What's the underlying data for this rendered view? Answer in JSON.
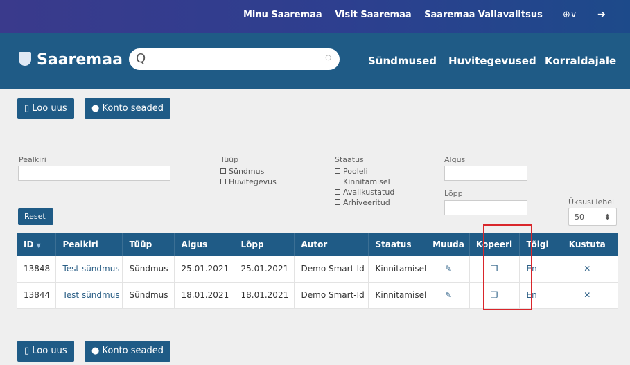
{
  "topbar": {
    "links": [
      "Minu Saaremaa",
      "Visit Saaremaa",
      "Saaremaa Vallavalitsus"
    ],
    "globe": "⊕∨",
    "logout": "➔"
  },
  "mainbar": {
    "brand": "Saaremaa",
    "search_placeholder": "",
    "nav": [
      "Sündmused",
      "Huvitegevused",
      "Korraldajale"
    ]
  },
  "actions": {
    "new_label": "Loo uus",
    "account_label": "Konto seaded"
  },
  "filters": {
    "title_label": "Pealkiri",
    "type_label": "Tüüp",
    "type_options": [
      "Sündmus",
      "Huvitegevus"
    ],
    "status_label": "Staatus",
    "status_options": [
      "Pooleli",
      "Kinnitamisel",
      "Avalikustatud",
      "Arhiveeritud"
    ],
    "start_label": "Algus",
    "end_label": "Lõpp",
    "per_page_label": "Üksusi lehel",
    "per_page_value": "50",
    "reset_label": "Reset"
  },
  "table": {
    "columns": [
      "ID",
      "Pealkiri",
      "Tüüp",
      "Algus",
      "Lõpp",
      "Autor",
      "Staatus",
      "Muuda",
      "Kopeeri",
      "Tõlgi",
      "Kustuta"
    ],
    "rows": [
      [
        "13848",
        "Test sündmus",
        "Sündmus",
        "25.01.2021",
        "25.01.2021",
        "Demo Smart-Id",
        "Kinnitamisel",
        "✎",
        "❐",
        "En",
        "✕"
      ],
      [
        "13844",
        "Test sündmus",
        "Sündmus",
        "18.01.2021",
        "18.01.2021",
        "Demo Smart-Id",
        "Kinnitamisel",
        "✎",
        "❐",
        "En",
        "✕"
      ]
    ]
  }
}
